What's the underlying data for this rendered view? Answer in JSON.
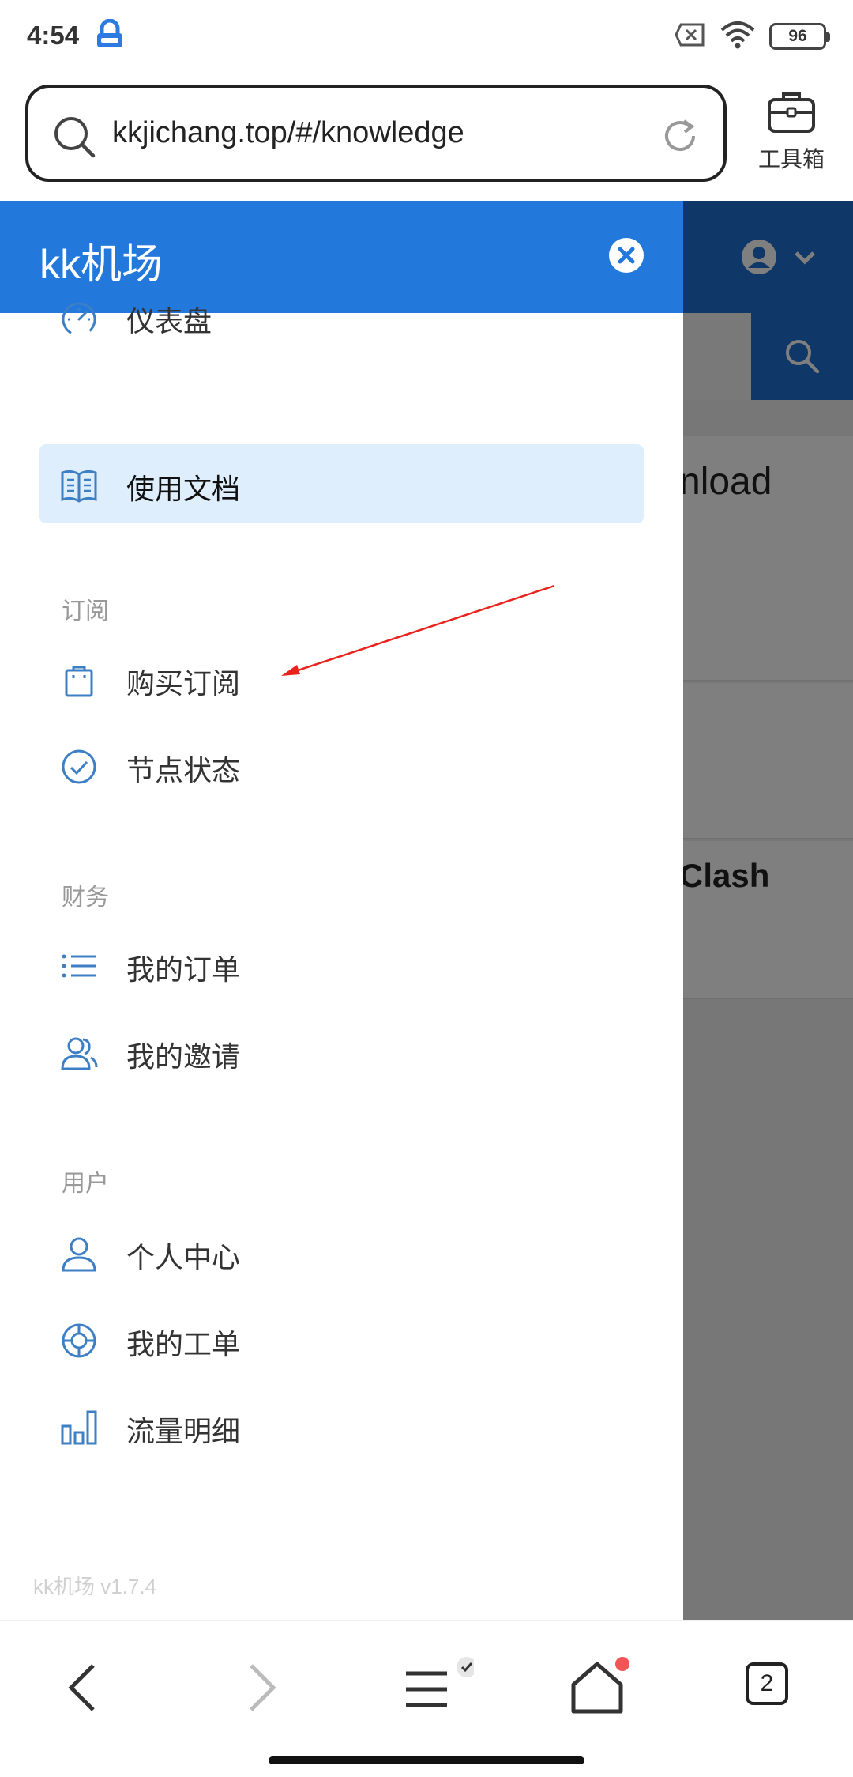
{
  "status_bar": {
    "time": "4:54",
    "battery": "96",
    "icons": [
      "app-notification-icon",
      "sim-x-icon",
      "wifi-icon",
      "battery-icon"
    ]
  },
  "browser": {
    "url": "kkjichang.top/#/knowledge",
    "toolbox_label": "工具箱",
    "tab_count": "2"
  },
  "background_page": {
    "card_titles": [
      "nload",
      "Clash"
    ]
  },
  "drawer": {
    "title": "kk机场",
    "items": [
      {
        "label": "仪表盘",
        "icon": "dashboard-gauge-icon",
        "active": false
      },
      {
        "label": "使用文档",
        "icon": "book-icon",
        "active": true
      }
    ],
    "sections": [
      {
        "label": "订阅",
        "items": [
          {
            "label": "购买订阅",
            "icon": "shopping-bag-icon"
          },
          {
            "label": "节点状态",
            "icon": "check-circle-icon"
          }
        ]
      },
      {
        "label": "财务",
        "items": [
          {
            "label": "我的订单",
            "icon": "list-icon"
          },
          {
            "label": "我的邀请",
            "icon": "users-icon"
          }
        ]
      },
      {
        "label": "用户",
        "items": [
          {
            "label": "个人中心",
            "icon": "user-icon"
          },
          {
            "label": "我的工单",
            "icon": "lifebuoy-icon"
          },
          {
            "label": "流量明细",
            "icon": "bar-chart-icon"
          }
        ]
      }
    ],
    "version": "kk机场 v1.7.4"
  },
  "colors": {
    "drawer_header": "#2379db",
    "page_header": "#1e6fcf",
    "active_item_bg": "#dfeefd",
    "icon_blue": "#3d7fc4",
    "annotation_arrow": "#e8231c",
    "notification_dot": "#f25555"
  }
}
